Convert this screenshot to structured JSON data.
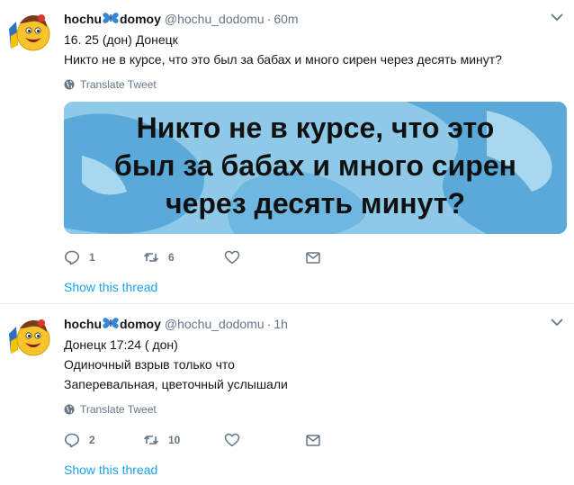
{
  "tweets": [
    {
      "name": "hochu",
      "name_suffix": "domoy",
      "handle": "@hochu_dodomu",
      "separator": "·",
      "time": "60m",
      "lines": [
        "16. 25 (дон) Донецк",
        "Никто не в курсе, что это был за бабах и много сирен через десять минут?"
      ],
      "translate_label": "Translate Tweet",
      "media_lines": [
        "Никто не в курсе, что это",
        "был за бабах и много сирен",
        "через десять минут?"
      ],
      "replies": "1",
      "retweets": "6",
      "likes": "",
      "show_thread": "Show this thread"
    },
    {
      "name": "hochu",
      "name_suffix": "domoy",
      "handle": "@hochu_dodomu",
      "separator": "·",
      "time": "1h",
      "lines": [
        "Донецк 17:24 ( дон)",
        "Одиночный взрыв только что",
        "Заперевальная, цветочный услышали"
      ],
      "translate_label": "Translate Tweet",
      "replies": "2",
      "retweets": "10",
      "likes": "",
      "show_thread": "Show this thread"
    }
  ],
  "colors": {
    "link": "#1da1f2",
    "secondary": "#657786",
    "text": "#14171a",
    "media_bg": "#8ecae8",
    "media_pattern": "#5aa9d9",
    "divider": "#e6ecf0"
  },
  "icons": {
    "avatar": "emoji-smiley-avatar",
    "name_badge": "butterfly-icon",
    "menu": "chevron-down-icon",
    "translate": "globe-icon",
    "reply": "reply-icon",
    "retweet": "retweet-icon",
    "like": "heart-icon",
    "message": "envelope-icon"
  }
}
